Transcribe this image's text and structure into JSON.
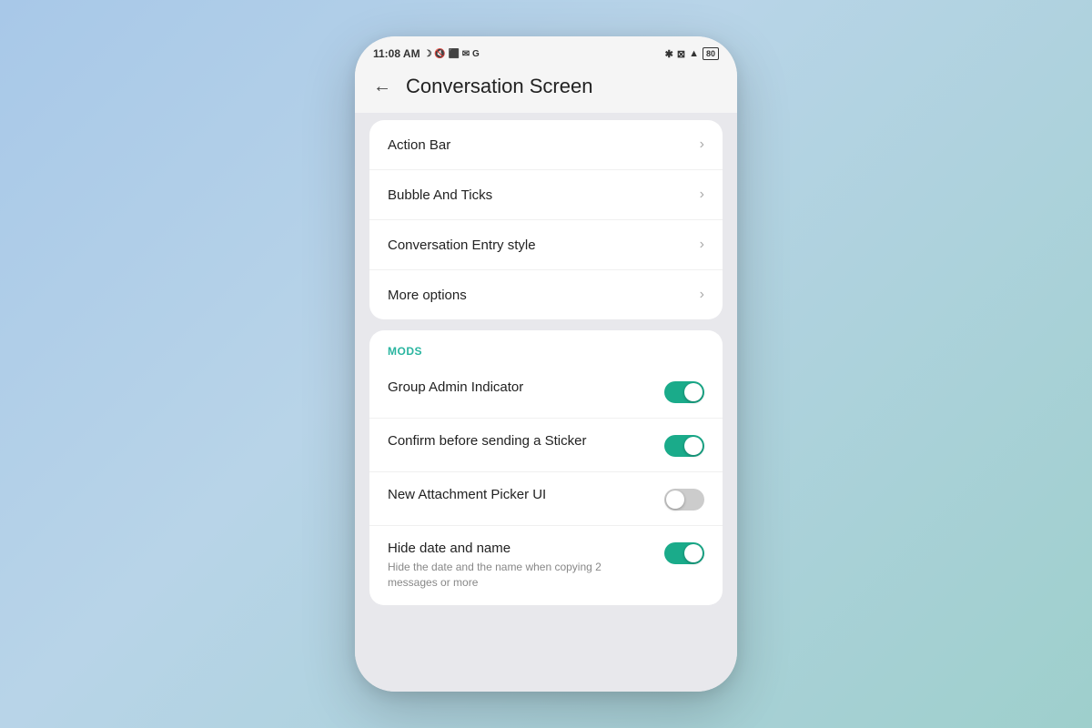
{
  "statusBar": {
    "time": "11:08 AM",
    "icons": "☽ 🔕 📍 ✉ G",
    "rightIcons": "✱ ⊡ ▲",
    "battery": "80"
  },
  "header": {
    "backLabel": "←",
    "title": "Conversation Screen"
  },
  "menuCard": {
    "items": [
      {
        "label": "Action Bar",
        "hasChevron": true
      },
      {
        "label": "Bubble And Ticks",
        "hasChevron": true
      },
      {
        "label": "Conversation Entry style",
        "hasChevron": true
      },
      {
        "label": "More options",
        "hasChevron": true
      }
    ]
  },
  "modsCard": {
    "sectionLabel": "MODS",
    "toggles": [
      {
        "label": "Group Admin Indicator",
        "sublabel": "",
        "state": "on"
      },
      {
        "label": "Confirm before sending a Sticker",
        "sublabel": "",
        "state": "on"
      },
      {
        "label": "New Attachment Picker UI",
        "sublabel": "",
        "state": "off"
      },
      {
        "label": "Hide date and name",
        "sublabel": "Hide the date and the name when copying 2 messages or more",
        "state": "on"
      }
    ]
  },
  "chevron": "›"
}
